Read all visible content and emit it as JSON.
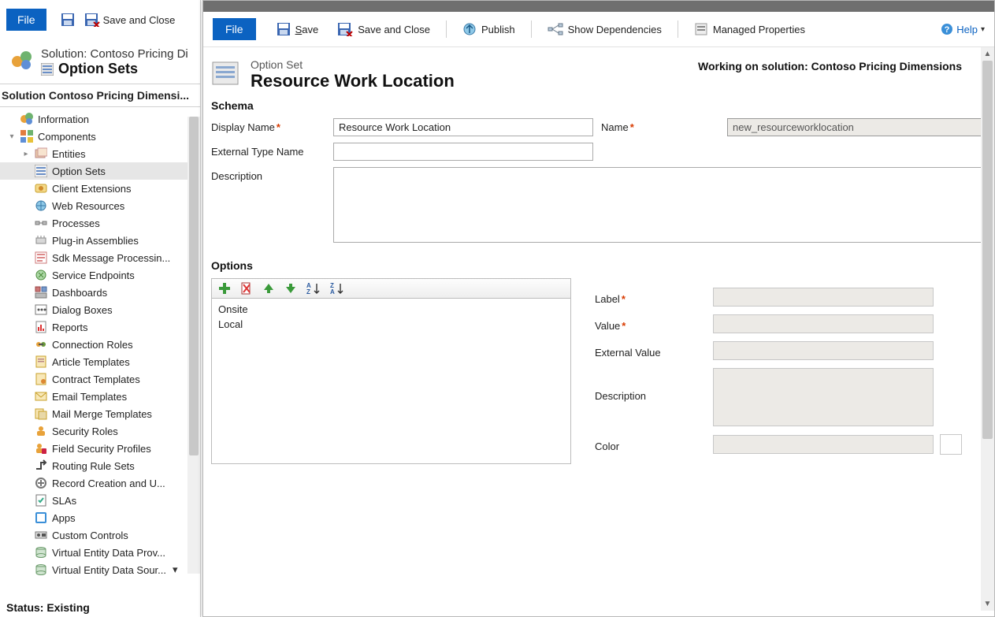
{
  "parent": {
    "toolbar": {
      "file": "File",
      "save_close": "Save and Close"
    },
    "header": {
      "solution_line": "Solution: Contoso Pricing Di",
      "page_title": "Option Sets"
    },
    "nav_title": "Solution Contoso Pricing Dimensi...",
    "tree": {
      "information": "Information",
      "components": "Components",
      "entities": "Entities",
      "option_sets": "Option Sets",
      "client_ext": "Client Extensions",
      "web_resources": "Web Resources",
      "processes": "Processes",
      "plugins": "Plug-in Assemblies",
      "sdk": "Sdk Message Processin...",
      "endpoints": "Service Endpoints",
      "dashboards": "Dashboards",
      "dialogs": "Dialog Boxes",
      "reports": "Reports",
      "conn_roles": "Connection Roles",
      "article_tpl": "Article Templates",
      "contract_tpl": "Contract Templates",
      "email_tpl": "Email Templates",
      "mailmerge_tpl": "Mail Merge Templates",
      "security_roles": "Security Roles",
      "field_security": "Field Security Profiles",
      "routing": "Routing Rule Sets",
      "record_creation": "Record Creation and U...",
      "slas": "SLAs",
      "apps": "Apps",
      "custom_controls": "Custom Controls",
      "virt_prov": "Virtual Entity Data Prov...",
      "virt_src": "Virtual Entity Data Sour..."
    },
    "status": "Status: Existing"
  },
  "dialog": {
    "toolbar": {
      "file": "File",
      "save": "Save",
      "save_close": "Save and Close",
      "publish": "Publish",
      "show_deps": "Show Dependencies",
      "managed_props": "Managed Properties",
      "help": "Help"
    },
    "header": {
      "type": "Option Set",
      "name": "Resource Work Location",
      "working": "Working on solution: Contoso Pricing Dimensions"
    },
    "schema": {
      "title": "Schema",
      "display_name_label": "Display Name",
      "display_name_value": "Resource Work Location",
      "name_label": "Name",
      "name_value": "new_resourceworklocation",
      "ext_type_label": "External Type Name",
      "ext_type_value": "",
      "description_label": "Description",
      "description_value": ""
    },
    "options": {
      "title": "Options",
      "items": [
        "Onsite",
        "Local"
      ],
      "label_label": "Label",
      "value_label": "Value",
      "extval_label": "External Value",
      "desc_label": "Description",
      "color_label": "Color"
    }
  }
}
